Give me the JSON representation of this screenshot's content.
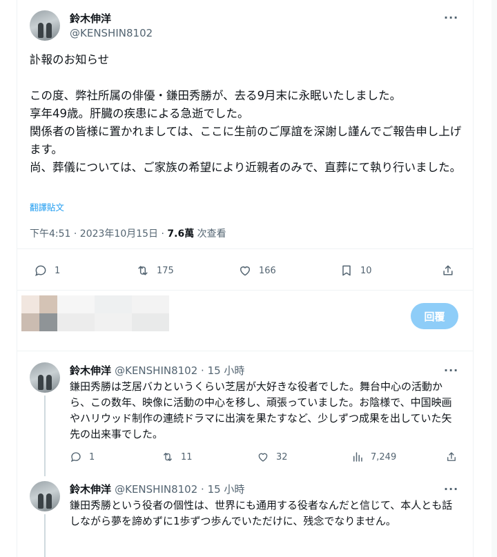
{
  "main_tweet": {
    "author_name": "鈴木伸洋",
    "handle": "@KENSHIN8102",
    "more": "···",
    "lines": [
      "訃報のお知らせ",
      "この度、弊社所属の俳優・鎌田秀勝が、去る9月末に永眠いたしました。",
      "享年49歳。肝臓の疾患による急逝でした。",
      "関係者の皆様に置かれましては、ここに生前のご厚誼を深謝し謹んでご報告申し上げます。",
      "尚、葬儀については、ご家族の希望により近親者のみで、直葬にて執り行いました。"
    ],
    "translate_label": "翻譯貼文",
    "timestamp": "下午4:51 · 2023年10月15日 · ",
    "views": "7.6萬",
    "views_label": " 次查看",
    "actions": {
      "reply": "1",
      "retweet": "175",
      "like": "166",
      "bookmark": "10"
    }
  },
  "composer": {
    "reply_button": "回覆"
  },
  "replies": [
    {
      "author_name": "鈴木伸洋",
      "meta": "@KENSHIN8102 · 15 小時",
      "more": "···",
      "text": "鎌田秀勝は芝居バカというくらい芝居が大好きな役者でした。舞台中心の活動から、この数年、映像に活動の中心を移し、頑張っていました。お陰様で、中国映画やハリウッド制作の連続ドラマに出演を果たすなど、少しずつ成果を出していた矢先の出来事でした。",
      "actions": {
        "reply": "1",
        "retweet": "11",
        "like": "32",
        "views": "7,249"
      }
    },
    {
      "author_name": "鈴木伸洋",
      "meta": "@KENSHIN8102 · 15 小時",
      "more": "···",
      "text": "鎌田秀勝という役者の個性は、世界にも通用する役者なんだと信じて、本人とも話しながら夢を諦めずに1歩ずつ歩んでいただけに、残念でなりません。"
    }
  ],
  "colors": {
    "accent": "#1d9bf0",
    "reply_button_disabled": "#8ecdf8",
    "secondary_text": "#536471"
  }
}
